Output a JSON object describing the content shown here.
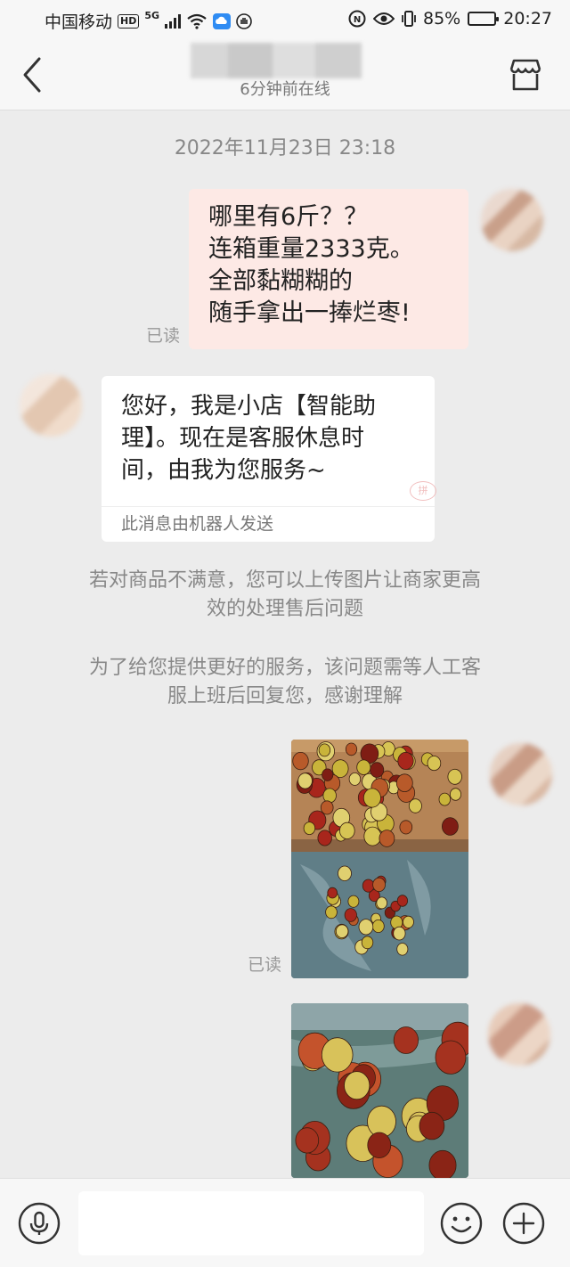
{
  "status_bar": {
    "carrier": "中国移动",
    "hd_badge": "HD",
    "network": "5G",
    "battery_percent": "85%",
    "battery_level": 0.85,
    "time": "20:27"
  },
  "header": {
    "subtitle": "6分钟前在线",
    "back_icon": "chevron-left-icon",
    "shop_icon": "storefront-icon"
  },
  "chat": {
    "timestamp": "2022年11月23日 23:18",
    "user_message": {
      "lines": [
        "哪里有6斤？？",
        "连箱重量2333克。",
        "全部黏糊糊的",
        "随手拿出一捧烂枣!"
      ],
      "read_status": "已读"
    },
    "bot_message": {
      "lines": [
        "您好，我是小店【智能助",
        "理】。现在是客服休息时",
        "间，由我为您服务~"
      ],
      "footer": "此消息由机器人发送",
      "stamp": "拼"
    },
    "system_notices": [
      {
        "lines": [
          "若对商品不满意，您可以上传图片让商家更高",
          "效的处理售后问题"
        ]
      },
      {
        "lines": [
          "为了给您提供更好的服务，该问题需等人工客",
          "服上班后回复您，感谢理解"
        ]
      }
    ],
    "photo_message_read": "已读"
  },
  "input_bar": {
    "placeholder": "",
    "voice_icon": "microphone-icon",
    "emoji_icon": "emoji-icon",
    "plus_icon": "plus-icon"
  },
  "colors": {
    "background": "#ececec",
    "bar": "#f7f7f7",
    "user_bubble": "#fde9e5",
    "bot_bubble": "#ffffff",
    "muted_text": "#888888"
  }
}
